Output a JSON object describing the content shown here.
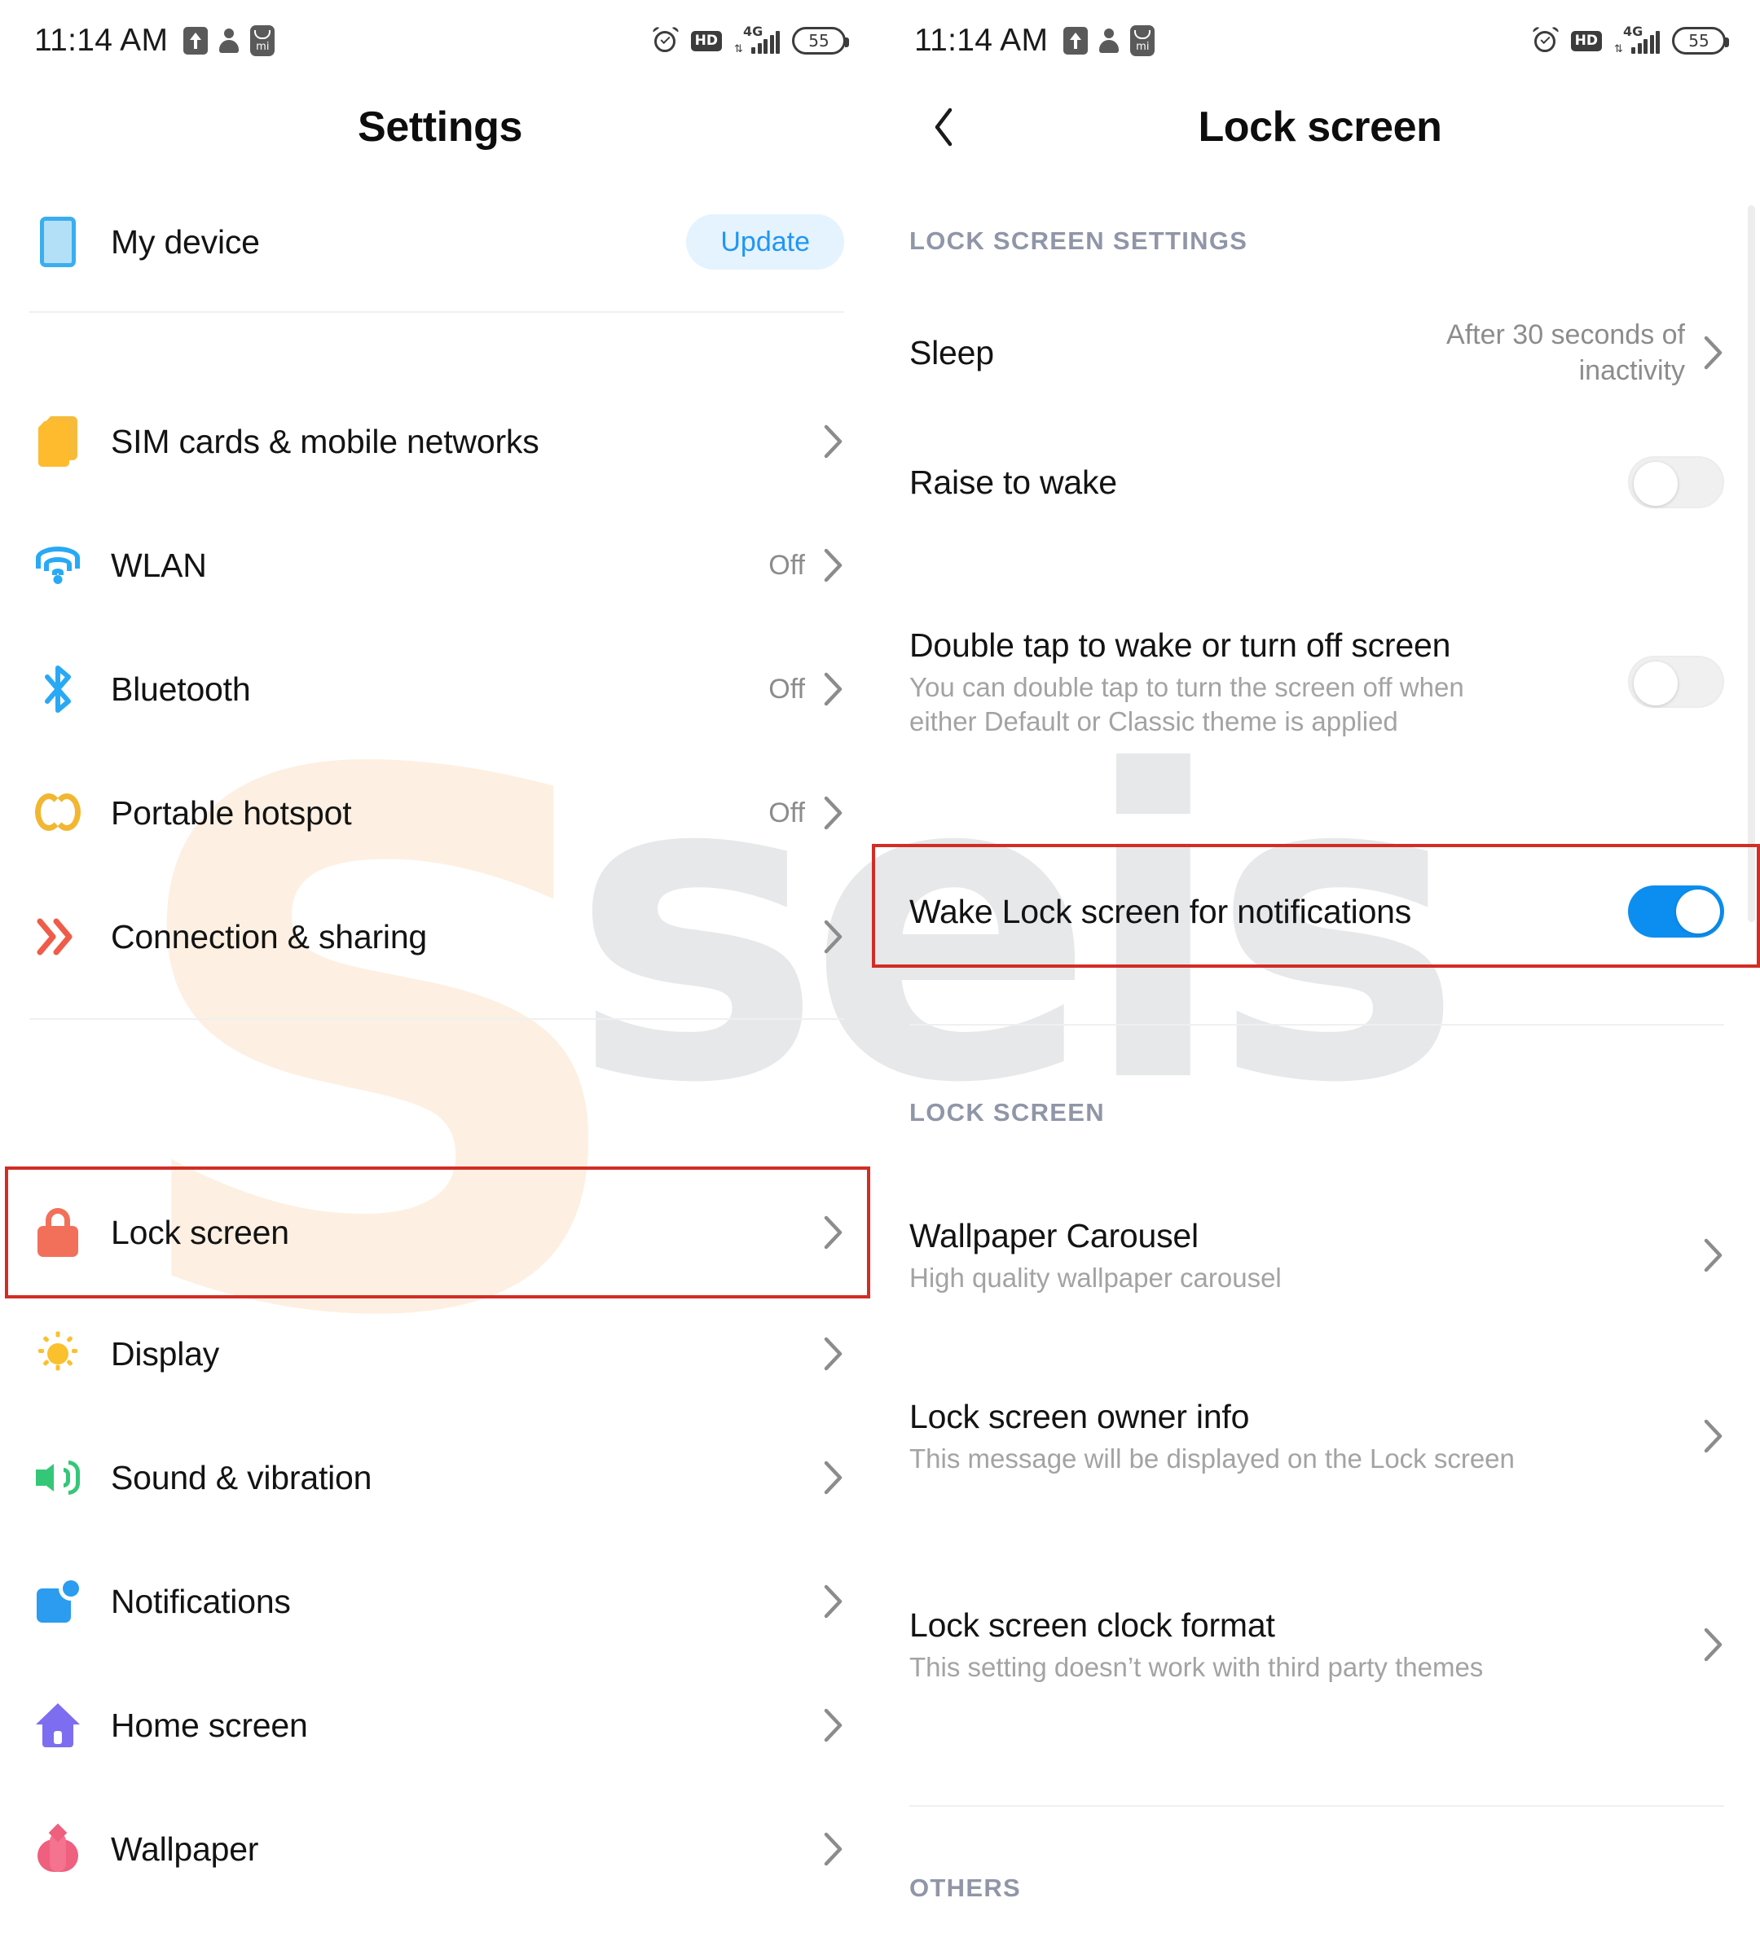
{
  "status_bar": {
    "time": "11:14 AM",
    "battery": "55",
    "network": "4G",
    "hd_label": "HD",
    "left_icons": [
      "upload-icon",
      "person-icon",
      "mi-account-icon"
    ],
    "right_icons": [
      "alarm-icon",
      "hd-icon",
      "signal-icon",
      "battery-icon"
    ]
  },
  "left_panel": {
    "title": "Settings",
    "items": [
      {
        "label": "My device",
        "icon": "device-icon",
        "badge": "Update",
        "value": "",
        "chevron": false
      },
      {
        "label": "SIM cards & mobile networks",
        "icon": "sim-icon",
        "badge": "",
        "value": "",
        "chevron": true
      },
      {
        "label": "WLAN",
        "icon": "wifi-icon",
        "badge": "",
        "value": "Off",
        "chevron": true
      },
      {
        "label": "Bluetooth",
        "icon": "bluetooth-icon",
        "badge": "",
        "value": "Off",
        "chevron": true
      },
      {
        "label": "Portable hotspot",
        "icon": "hotspot-icon",
        "badge": "",
        "value": "Off",
        "chevron": true
      },
      {
        "label": "Connection & sharing",
        "icon": "connection-icon",
        "badge": "",
        "value": "",
        "chevron": true
      },
      {
        "label": "Lock screen",
        "icon": "lock-icon",
        "badge": "",
        "value": "",
        "chevron": true,
        "highlighted": true
      },
      {
        "label": "Display",
        "icon": "sun-icon",
        "badge": "",
        "value": "",
        "chevron": true
      },
      {
        "label": "Sound & vibration",
        "icon": "speaker-icon",
        "badge": "",
        "value": "",
        "chevron": true
      },
      {
        "label": "Notifications",
        "icon": "notification-icon",
        "badge": "",
        "value": "",
        "chevron": true
      },
      {
        "label": "Home screen",
        "icon": "home-icon",
        "badge": "",
        "value": "",
        "chevron": true
      },
      {
        "label": "Wallpaper",
        "icon": "wallpaper-icon",
        "badge": "",
        "value": "",
        "chevron": true
      }
    ]
  },
  "right_panel": {
    "title": "Lock screen",
    "back_icon": "back-chevron-icon",
    "sections": [
      {
        "heading": "LOCK SCREEN SETTINGS",
        "items": [
          {
            "title": "Sleep",
            "subtitle": "",
            "value": "After 30 seconds of inactivity",
            "control": "chevron"
          },
          {
            "title": "Raise to wake",
            "subtitle": "",
            "value": "",
            "control": "toggle",
            "toggle_on": false
          },
          {
            "title": "Double tap to wake or turn off screen",
            "subtitle": "You can double tap to turn the screen off when either Default or Classic theme is applied",
            "value": "",
            "control": "toggle",
            "toggle_on": false
          },
          {
            "title": "Wake Lock screen for notifications",
            "subtitle": "",
            "value": "",
            "control": "toggle",
            "toggle_on": true,
            "highlighted": true
          }
        ]
      },
      {
        "heading": "LOCK SCREEN",
        "items": [
          {
            "title": "Wallpaper Carousel",
            "subtitle": "High quality wallpaper carousel",
            "value": "",
            "control": "chevron"
          },
          {
            "title": "Lock screen owner info",
            "subtitle": "This message will be displayed on the Lock screen",
            "value": "",
            "control": "chevron"
          },
          {
            "title": "Lock screen clock format",
            "subtitle": "This setting doesn’t work with third party themes",
            "value": "",
            "control": "chevron"
          }
        ]
      },
      {
        "heading": "OTHERS",
        "items": []
      }
    ]
  },
  "watermark": {
    "logo": "S",
    "text": "seis"
  },
  "colors": {
    "highlight_border": "#d22d25",
    "toggle_on": "#0c8ef0",
    "toggle_off": "#f0f0f0",
    "accent_blue": "#2196f3",
    "badge_bg": "#e4f3fd",
    "section_heading": "#9096a8",
    "subtitle_gray": "#a3a3a3"
  }
}
